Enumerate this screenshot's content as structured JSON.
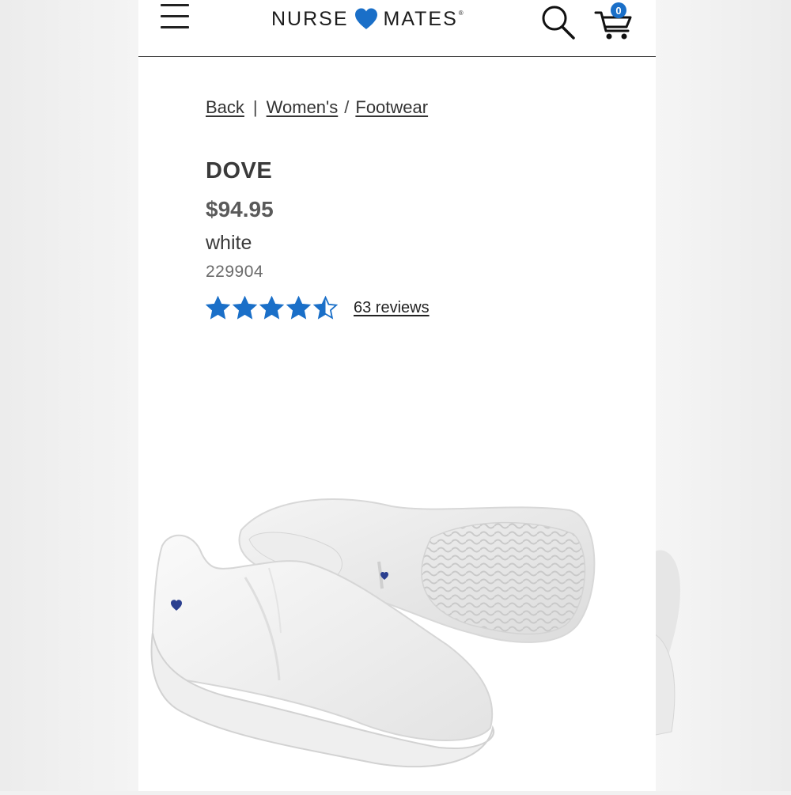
{
  "header": {
    "brand_left": "NURSE",
    "brand_right": "MATES",
    "brand_mark": "®",
    "cart_count": "0",
    "accent_color": "#1a6fc8"
  },
  "breadcrumb": {
    "back": "Back",
    "separator_1": "|",
    "womens": "Women's",
    "separator_2": "/",
    "footwear": "Footwear"
  },
  "product": {
    "name": "DOVE",
    "price": "$94.95",
    "color": "white",
    "sku": "229904",
    "rating": 4.5,
    "rating_max": 5,
    "reviews_label": "63 reviews"
  },
  "icons": {
    "menu": "hamburger-menu-icon",
    "logo_heart": "heart-icon",
    "search": "search-icon",
    "cart": "shopping-cart-icon",
    "star": "star-icon"
  }
}
